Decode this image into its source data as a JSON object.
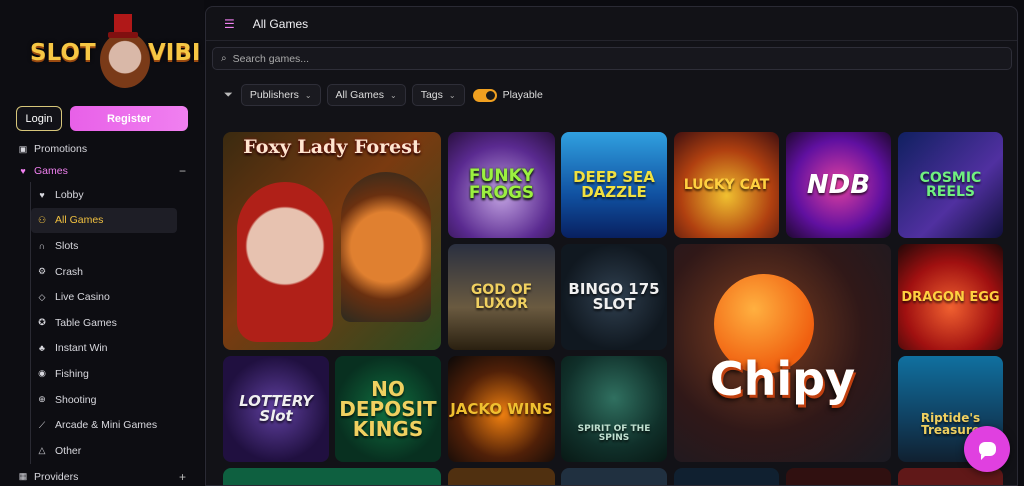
{
  "brand": {
    "logo_left": "SLOT",
    "logo_right": "VIBI"
  },
  "auth": {
    "login_label": "Login",
    "register_label": "Register"
  },
  "nav": {
    "promotions": "Promotions",
    "games": "Games",
    "games_toggle": "−",
    "sub_items": [
      {
        "label": "Lobby",
        "icon": "heart-icon"
      },
      {
        "label": "All Games",
        "icon": "person-icon"
      },
      {
        "label": "Slots",
        "icon": "headphones-icon"
      },
      {
        "label": "Crash",
        "icon": "gear-icon"
      },
      {
        "label": "Live Casino",
        "icon": "diamond-icon"
      },
      {
        "label": "Table Games",
        "icon": "chip-icon"
      },
      {
        "label": "Instant Win",
        "icon": "clover-icon"
      },
      {
        "label": "Fishing",
        "icon": "fish-icon"
      },
      {
        "label": "Shooting",
        "icon": "target-icon"
      },
      {
        "label": "Arcade & Mini Games",
        "icon": "joystick-icon"
      },
      {
        "label": "Other",
        "icon": "shapes-icon"
      }
    ],
    "providers": "Providers",
    "providers_toggle": "+"
  },
  "header": {
    "title": "All Games"
  },
  "search": {
    "placeholder": "Search games..."
  },
  "filters": {
    "publishers": "Publishers",
    "all_games": "All Games",
    "tags": "Tags",
    "playable_label": "Playable",
    "playable_on": true
  },
  "games": {
    "foxy": "Foxy Lady Forest",
    "frogs": "FUNKY FROGS",
    "deep": "DEEP SEA DAZZLE",
    "lucky": "LUCKY CAT",
    "ndb": "NDB",
    "cosmic": "COSMIC REELS",
    "luxor": "GOD OF LUXOR",
    "bingo": "BINGO 175 SLOT",
    "chipy": "Chipy",
    "dragon": "DRAGON EGG",
    "lottery": "LOTTERY Slot",
    "kings": "NO DEPOSIT KINGS",
    "jacko": "JACKO WINS",
    "spirit": "SPIRIT OF THE SPINS",
    "riptide": "Riptide's Treasure"
  },
  "colors": {
    "accent": "#f080f0",
    "active": "#f0c040",
    "toggle": "#f0a020"
  }
}
